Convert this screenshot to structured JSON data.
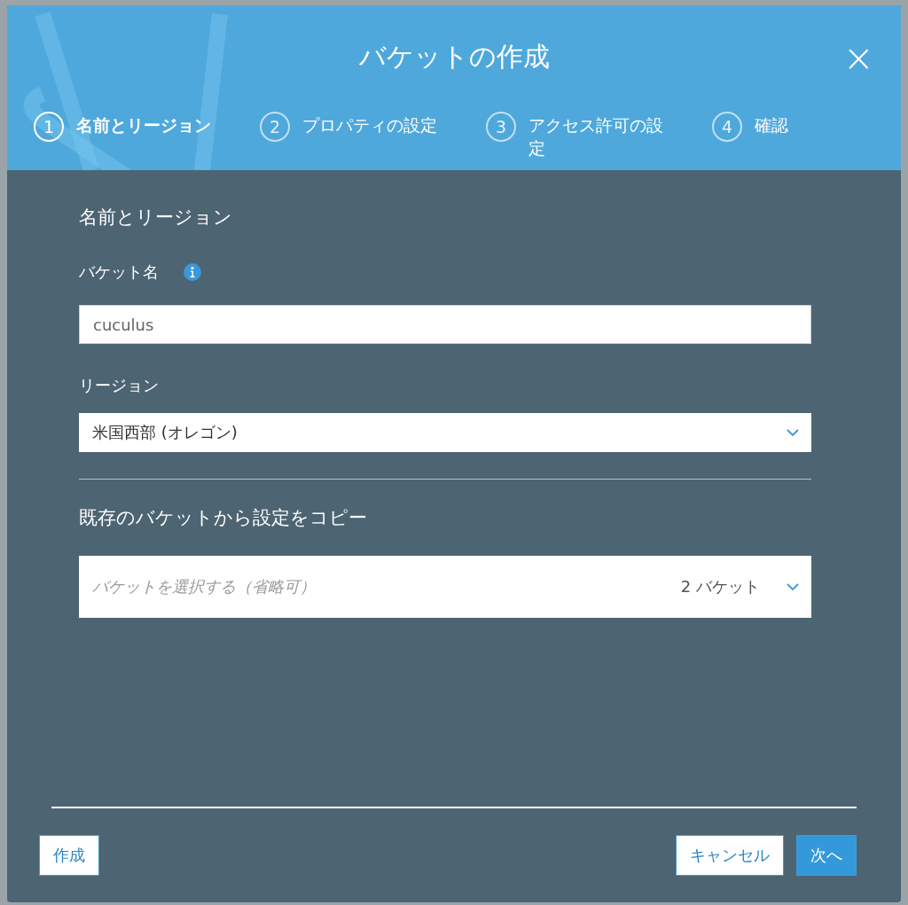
{
  "dialog": {
    "title": "バケットの作成",
    "close": "×"
  },
  "steps": [
    {
      "number": "1",
      "label": "名前とリージョン",
      "selected": true
    },
    {
      "number": "2",
      "label": "プロパティの設定",
      "selected": false
    },
    {
      "number": "3",
      "label": "アクセス許可の設定",
      "selected": false
    },
    {
      "number": "4",
      "label": "確認",
      "selected": false
    }
  ],
  "section_title": "名前とリージョン",
  "bucket_name": {
    "label": "バケット名",
    "value": "cuculus"
  },
  "region": {
    "label": "リージョン",
    "value": "米国西部 (オレゴン)"
  },
  "copy_section": {
    "title": "既存のバケットから設定をコピー",
    "placeholder": "バケットを選択する（省略可）",
    "count": "2 バケット"
  },
  "footer": {
    "create": "作成",
    "cancel": "キャンセル",
    "next": "次へ"
  }
}
